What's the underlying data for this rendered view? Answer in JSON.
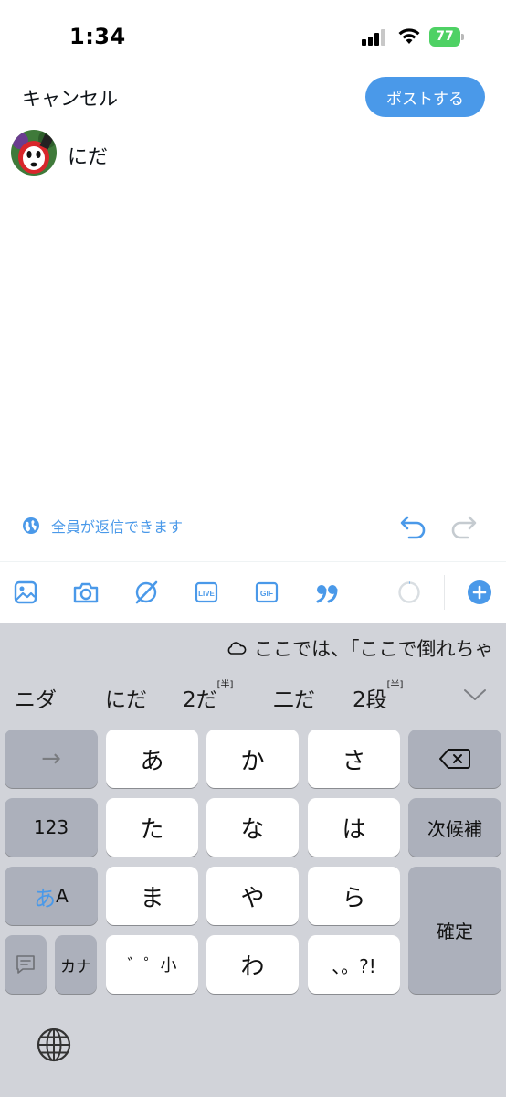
{
  "status_bar": {
    "time": "1:34",
    "battery_level": "77",
    "signal_bars_active": 3
  },
  "header": {
    "cancel_label": "キャンセル",
    "post_label": "ポストする",
    "accent_color": "#4a99e9"
  },
  "composer": {
    "text": "にだ",
    "avatar": "avatar-icon"
  },
  "reply_settings": {
    "label": "全員が返信できます",
    "icon": "globe-icon"
  },
  "toolbar": {
    "items": [
      "image-icon",
      "camera-icon",
      "grok-icon",
      "live-icon",
      "gif-icon",
      "quote-icon",
      "progress-ring-icon",
      "add-icon"
    ],
    "live_label": "LIVE",
    "gif_label": "GIF"
  },
  "keyboard": {
    "live_conversion": "ここでは、「ここで倒れちゃ",
    "candidates": [
      {
        "text": "ニダ",
        "sup": ""
      },
      {
        "text": "にだ",
        "sup": ""
      },
      {
        "text": "2だ",
        "sup": "[半]"
      },
      {
        "text": "二だ",
        "sup": ""
      },
      {
        "text": "2段",
        "sup": "[半]"
      }
    ],
    "keys": {
      "arrow": "→",
      "a": "あ",
      "ka": "か",
      "sa": "さ",
      "num": "123",
      "ta": "た",
      "na": "な",
      "ha": "は",
      "next_candidate": "次候補",
      "mode_kana": "あ",
      "mode_alpha": "A",
      "ma": "ま",
      "ya": "や",
      "ra": "ら",
      "confirm": "確定",
      "kana": "カナ",
      "dakuten": "゛゜小",
      "wa": "わ",
      "punct": "、。?!"
    }
  }
}
